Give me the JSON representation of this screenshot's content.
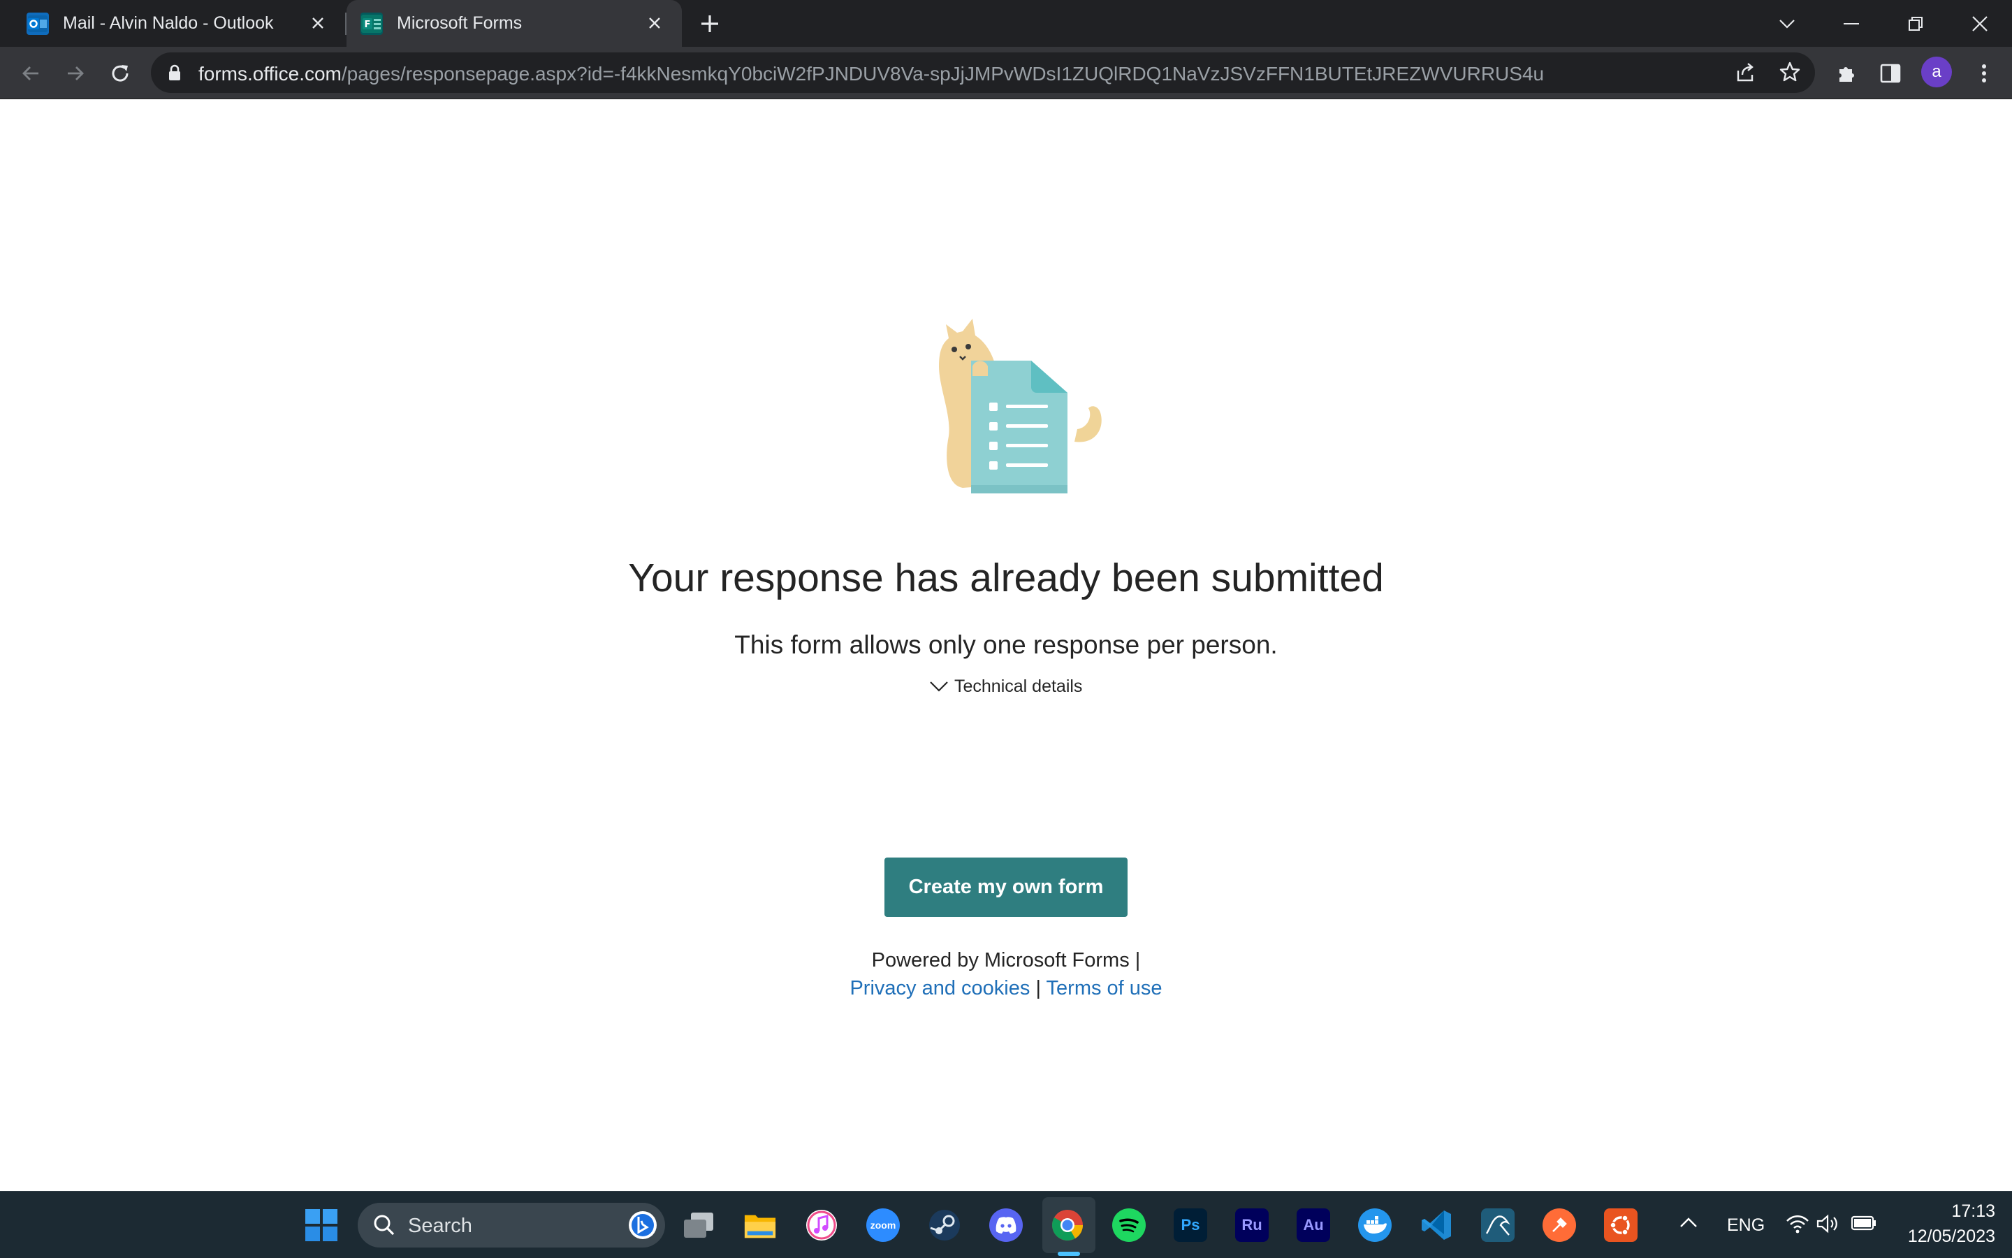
{
  "browser": {
    "tabs": [
      {
        "label": "Mail - Alvin Naldo - Outlook",
        "favicon": "outlook-icon",
        "active": false
      },
      {
        "label": "Microsoft Forms",
        "favicon": "forms-icon",
        "active": true
      }
    ],
    "address": {
      "host": "forms.office.com",
      "path": "/pages/responsepage.aspx?id=-f4kkNesmkqY0bciW2fPJNDUV8Va-spJjJMPvWDsI1ZUQlRDQ1NaVzJSVzFFN1BUTEtJREZWVURRUS4u"
    },
    "profile_initial": "a"
  },
  "page": {
    "title": "Your response has already been submitted",
    "subtitle": "This form allows only one response per person.",
    "technical_details": "Technical details",
    "create_button": "Create my own form",
    "powered_by": "Powered by Microsoft Forms |",
    "privacy_link": "Privacy and cookies",
    "separator": "|",
    "terms_link": "Terms of use"
  },
  "taskbar": {
    "search_placeholder": "Search",
    "apps": [
      "start-icon",
      "task-view-icon",
      "file-explorer-icon",
      "itunes-icon",
      "zoom-icon",
      "steam-icon",
      "discord-icon",
      "chrome-icon",
      "spotify-icon",
      "photoshop-icon",
      "premiere-rush-icon",
      "audition-icon",
      "docker-icon",
      "vscode-icon",
      "mysql-workbench-icon",
      "postman-icon",
      "ubuntu-icon"
    ],
    "zoom_label": "zoom",
    "ps_label": "Ps",
    "ru_label": "Ru",
    "au_label": "Au",
    "language": "ENG",
    "time": "17:13",
    "date": "12/05/2023"
  },
  "colors": {
    "accent": "#2f7e80",
    "link": "#1f6fb8",
    "chrome_dark": "#202124",
    "taskbar": "#1c2a33"
  }
}
